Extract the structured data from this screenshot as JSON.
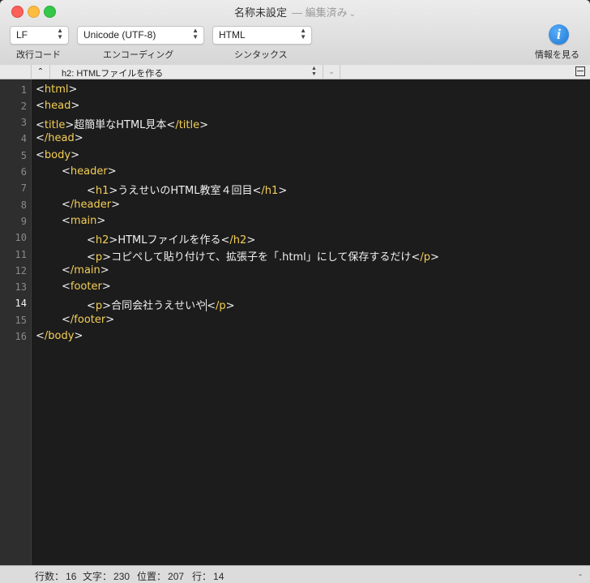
{
  "window": {
    "title": "名称未設定",
    "title_suffix": "— 編集済み",
    "suffix_chevron": "⌄"
  },
  "toolbar": {
    "line_ending": {
      "value": "LF",
      "label": "改行コード"
    },
    "encoding": {
      "value": "Unicode (UTF-8)",
      "label": "エンコーディング"
    },
    "syntax": {
      "value": "HTML",
      "label": "シンタックス"
    },
    "inspector": {
      "icon": "i",
      "label": "情報を見る"
    }
  },
  "navigation": {
    "up_glyph": "⌃",
    "outline_item": "h2: HTMLファイルを作る",
    "updown_glyph": "⌃⌄",
    "drop_glyph": "⌄"
  },
  "editor": {
    "current_line": 14,
    "lines": [
      {
        "no": "1"
      },
      {
        "no": "2"
      },
      {
        "no": "3"
      },
      {
        "no": "4"
      },
      {
        "no": "5"
      },
      {
        "no": "6"
      },
      {
        "no": "7"
      },
      {
        "no": "8"
      },
      {
        "no": "9"
      },
      {
        "no": "10"
      },
      {
        "no": "11"
      },
      {
        "no": "12"
      },
      {
        "no": "13"
      },
      {
        "no": "14"
      },
      {
        "no": "15"
      },
      {
        "no": "16"
      }
    ],
    "code": {
      "l1_tag": "html",
      "l2_tag": "head",
      "l3_tag": "title",
      "l3_text": "超簡単なHTML見本",
      "l3_close": "/title",
      "l4_tag": "/head",
      "l5_tag": "body",
      "l6_tag": "header",
      "l7_tag": "h1",
      "l7_text": "うえせいのHTML教室４回目",
      "l7_close": "/h1",
      "l8_tag": "/header",
      "l9_tag": "main",
      "l10_tag": "h2",
      "l10_text": "HTMLファイルを作る",
      "l10_close": "/h2",
      "l11_tag": "p",
      "l11_text": "コピペして貼り付けて、拡張子を「.html」にして保存するだけ",
      "l11_close": "/p",
      "l12_tag": "/main",
      "l13_tag": "footer",
      "l14_tag": "p",
      "l14_text": "合同会社うえせいや",
      "l14_close": "/p",
      "l15_tag": "/footer",
      "l16_tag": "/body"
    }
  },
  "status": {
    "lines_label": "行数：",
    "lines_value": "16",
    "chars_label": "文字：",
    "chars_value": "230",
    "position_label": "位置：",
    "position_value": "207",
    "row_label": "行：",
    "row_value": "14",
    "end_mark": "-"
  },
  "colors": {
    "tag": "#f5cf55",
    "text": "#f0f0f0",
    "editor_bg": "#1c1c1c"
  }
}
